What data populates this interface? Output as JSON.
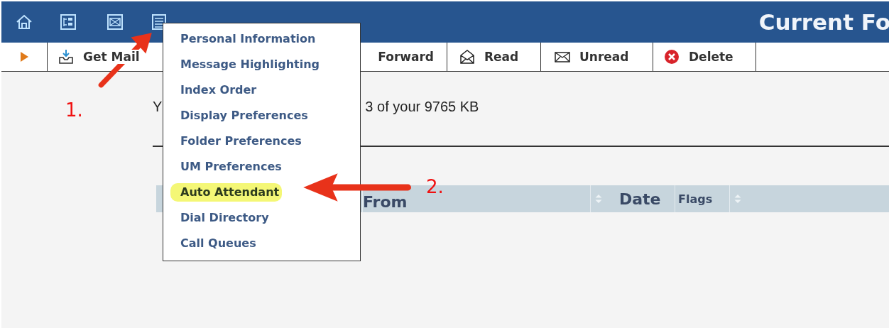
{
  "header": {
    "title": "Current Fo"
  },
  "toolbar": [
    {
      "kind": "expand"
    },
    {
      "kind": "get",
      "label": "Get Mail"
    },
    {
      "kind": "forward",
      "label": "Forward"
    },
    {
      "kind": "read",
      "label": "Read"
    },
    {
      "kind": "unread",
      "label": "Unread"
    },
    {
      "kind": "delete",
      "label": "Delete"
    }
  ],
  "quota": {
    "start": "Y",
    "end": "3 of your 9765 KB"
  },
  "table": {
    "columns": [
      {
        "label": "From",
        "sort_icon": false
      },
      {
        "label": "Date",
        "sort_icon": true
      },
      {
        "label": "Flags",
        "sort_icon": false
      },
      {
        "sort_icon": true
      }
    ]
  },
  "menu": {
    "items": [
      {
        "label": "Personal Information",
        "selected": false
      },
      {
        "label": "Message Highlighting",
        "selected": false
      },
      {
        "label": "Index Order",
        "selected": false
      },
      {
        "label": "Display Preferences",
        "selected": false
      },
      {
        "label": "Folder Preferences",
        "selected": false
      },
      {
        "label": "UM Preferences",
        "selected": false
      },
      {
        "label": "Auto Attendant",
        "selected": true
      },
      {
        "label": "Dial Directory",
        "selected": false
      },
      {
        "label": "Call Queues",
        "selected": false
      }
    ]
  },
  "annotations": [
    {
      "label": "1."
    },
    {
      "label": "2."
    }
  ]
}
